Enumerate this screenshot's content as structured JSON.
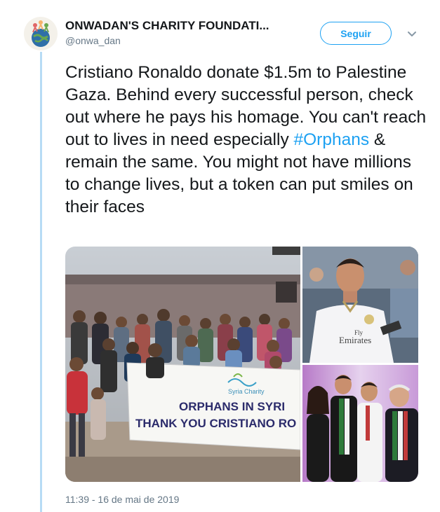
{
  "account": {
    "display_name": "ONWADAN'S CHARITY FOUNDATI...",
    "handle": "@onwa_dan"
  },
  "actions": {
    "follow_label": "Seguir",
    "more_icon": "chevron-down-icon"
  },
  "tweet": {
    "text_before_hashtag": "Cristiano Ronaldo donate $1.5m to Palestine Gaza. Behind every successful person, check out where he pays his homage. You can't reach out to lives in need especially ",
    "hashtag": "#Orphans",
    "text_after_hashtag": " & remain the same. You might not have millions to change lives, but a token can put smiles on their faces",
    "timestamp": "11:39 - 16 de mai de 2019"
  },
  "media": {
    "banner_brand": "Syria Charity",
    "banner_line1": "ORPHANS IN SYRI",
    "banner_line2": "THANK YOU CRISTIANO RO",
    "shirt_text_small": "Fly",
    "shirt_text": "Emirates"
  },
  "colors": {
    "accent": "#1da1f2",
    "thread_line": "#b7dcf5",
    "secondary_text": "#657786"
  }
}
